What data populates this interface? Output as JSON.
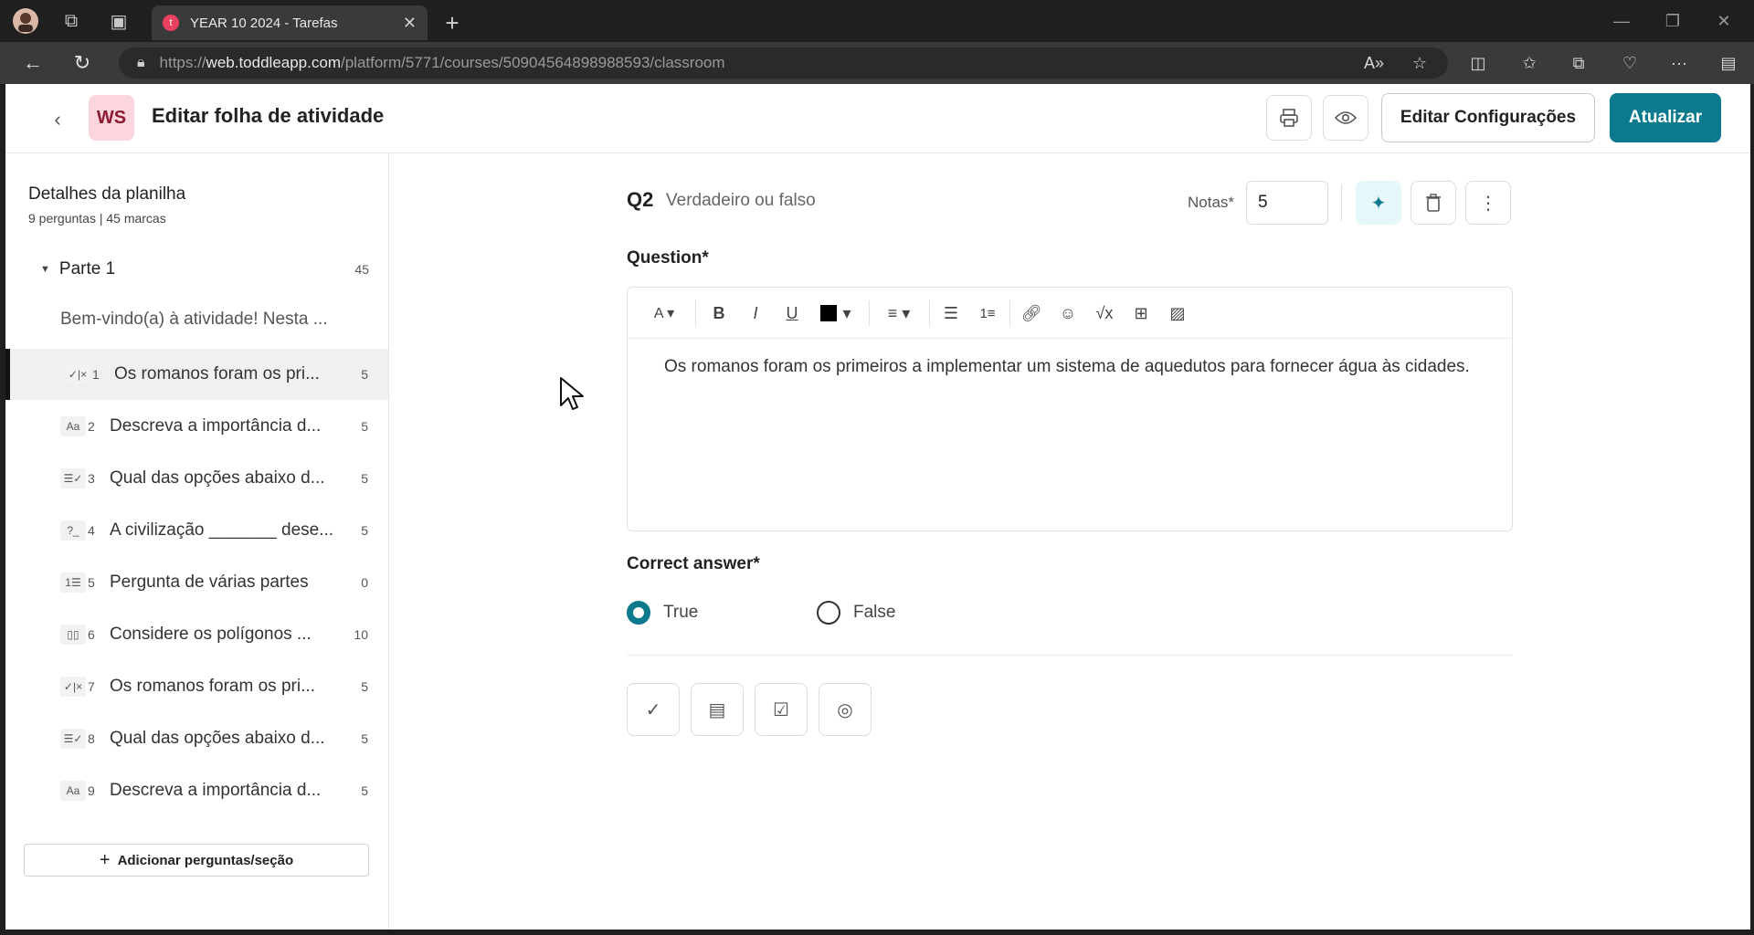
{
  "browser": {
    "tab_title": "YEAR 10 2024 - Tarefas",
    "tab_favicon_letter": "t",
    "url_prefix": "https://",
    "url_domain": "web.toddleapp.com",
    "url_path": "/platform/5771/courses/50904564898988593/classroom"
  },
  "header": {
    "badge": "WS",
    "title": "Editar folha de atividade",
    "edit_settings_label": "Editar Configurações",
    "update_label": "Atualizar"
  },
  "sidebar": {
    "title": "Detalhes da planilha",
    "subtitle": "9 perguntas | 45 marcas",
    "part_label": "Parte 1",
    "part_count": "45",
    "welcome": "Bem-vindo(a) à atividade! Nesta ...",
    "items": [
      {
        "type": "✓|×",
        "num": "1",
        "text": "Os romanos foram os pri...",
        "marks": "5"
      },
      {
        "type": "Aa",
        "num": "2",
        "text": "Descreva a importância d...",
        "marks": "5"
      },
      {
        "type": "☰✓",
        "num": "3",
        "text": "Qual das opções abaixo d...",
        "marks": "5"
      },
      {
        "type": "?_",
        "num": "4",
        "text": "A civilização _______ dese...",
        "marks": "5"
      },
      {
        "type": "1☰",
        "num": "5",
        "text": "Pergunta de várias partes",
        "marks": "0"
      },
      {
        "type": "▯▯",
        "num": "6",
        "text": "Considere os polígonos ...",
        "marks": "10"
      },
      {
        "type": "✓|×",
        "num": "7",
        "text": "Os romanos foram os pri...",
        "marks": "5"
      },
      {
        "type": "☰✓",
        "num": "8",
        "text": "Qual das opções abaixo d...",
        "marks": "5"
      },
      {
        "type": "Aa",
        "num": "9",
        "text": "Descreva a importância d...",
        "marks": "5"
      }
    ],
    "add_label": "Adicionar perguntas/seção"
  },
  "editor": {
    "q_label": "Q2",
    "q_type": "Verdadeiro ou falso",
    "notas_label": "Notas*",
    "notas_value": "5",
    "question_label": "Question*",
    "question_text": "Os romanos foram os primeiros a implementar um sistema de aquedutos para fornecer água às cidades.",
    "correct_label": "Correct answer*",
    "option_true": "True",
    "option_false": "False",
    "selected": "True"
  },
  "colors": {
    "primary": "#0b7a8c",
    "badge_bg": "#fbd6de"
  }
}
